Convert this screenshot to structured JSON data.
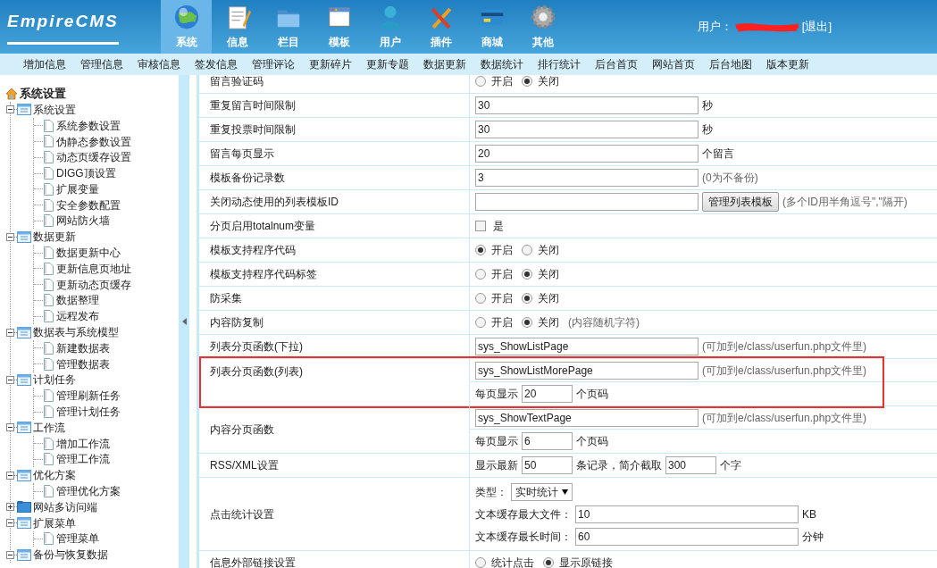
{
  "logo": "EmpireCMS",
  "nav": [
    {
      "label": "系统",
      "selected": true
    },
    {
      "label": "信息",
      "selected": false
    },
    {
      "label": "栏目",
      "selected": false
    },
    {
      "label": "模板",
      "selected": false
    },
    {
      "label": "用户",
      "selected": false
    },
    {
      "label": "插件",
      "selected": false
    },
    {
      "label": "商城",
      "selected": false
    },
    {
      "label": "其他",
      "selected": false
    }
  ],
  "user": {
    "label": "用户：",
    "logout": "[退出]"
  },
  "submenu": [
    "增加信息",
    "管理信息",
    "审核信息",
    "签发信息",
    "管理评论",
    "更新碎片",
    "更新专题",
    "数据更新",
    "数据统计",
    "排行统计",
    "后台首页",
    "网站首页",
    "后台地图",
    "版本更新"
  ],
  "sidebar": {
    "root": "系统设置",
    "groups": [
      {
        "label": "系统设置",
        "expanded": true,
        "children": [
          "系统参数设置",
          "伪静态参数设置",
          "动态页缓存设置",
          "DIGG顶设置",
          "扩展变量",
          "安全参数配置",
          "网站防火墙"
        ]
      },
      {
        "label": "数据更新",
        "expanded": true,
        "children": [
          "数据更新中心",
          "更新信息页地址",
          "更新动态页缓存",
          "数据整理",
          "远程发布"
        ]
      },
      {
        "label": "数据表与系统模型",
        "expanded": true,
        "children": [
          "新建数据表",
          "管理数据表"
        ]
      },
      {
        "label": "计划任务",
        "expanded": true,
        "children": [
          "管理刷新任务",
          "管理计划任务"
        ]
      },
      {
        "label": "工作流",
        "expanded": true,
        "children": [
          "增加工作流",
          "管理工作流"
        ]
      },
      {
        "label": "优化方案",
        "expanded": true,
        "children": [
          "管理优化方案"
        ]
      },
      {
        "label": "网站多访问端",
        "expanded": false
      },
      {
        "label": "扩展菜单",
        "expanded": true,
        "children": [
          "管理菜单"
        ]
      },
      {
        "label": "备份与恢复数据",
        "expanded": true
      }
    ]
  },
  "settings": [
    {
      "label": "留言验证码",
      "highlighted": false,
      "lines": [
        [
          {
            "kind": "radio",
            "label": "开启",
            "selected": false
          },
          {
            "kind": "radio",
            "label": "关闭",
            "selected": true
          }
        ]
      ]
    },
    {
      "label": "重复留言时间限制",
      "highlighted": false,
      "lines": [
        [
          {
            "kind": "input",
            "value": "30"
          },
          {
            "kind": "text",
            "text": "秒"
          }
        ]
      ]
    },
    {
      "label": "重复投票时间限制",
      "highlighted": false,
      "lines": [
        [
          {
            "kind": "input",
            "value": "30"
          },
          {
            "kind": "text",
            "text": "秒"
          }
        ]
      ]
    },
    {
      "label": "留言每页显示",
      "highlighted": false,
      "lines": [
        [
          {
            "kind": "input",
            "value": "20"
          },
          {
            "kind": "text",
            "text": "个留言"
          }
        ]
      ]
    },
    {
      "label": "模板备份记录数",
      "highlighted": false,
      "lines": [
        [
          {
            "kind": "input",
            "value": "3"
          },
          {
            "kind": "note",
            "text": "(0为不备份)"
          }
        ]
      ]
    },
    {
      "label": "关闭动态使用的列表模板ID",
      "highlighted": false,
      "lines": [
        [
          {
            "kind": "input"
          },
          {
            "kind": "button",
            "label": "管理列表模板"
          },
          {
            "kind": "note",
            "text": "(多个ID用半角逗号\",\"隔开)"
          }
        ]
      ]
    },
    {
      "label": "分页启用totalnum变量",
      "highlighted": false,
      "lines": [
        [
          {
            "kind": "checkbox",
            "label": "是",
            "checked": false
          }
        ]
      ]
    },
    {
      "label": "模板支持程序代码",
      "highlighted": false,
      "lines": [
        [
          {
            "kind": "radio",
            "label": "开启",
            "selected": true
          },
          {
            "kind": "radio",
            "label": "关闭",
            "selected": false
          }
        ]
      ]
    },
    {
      "label": "模板支持程序代码标签",
      "highlighted": false,
      "lines": [
        [
          {
            "kind": "radio",
            "label": "开启",
            "selected": false
          },
          {
            "kind": "radio",
            "label": "关闭",
            "selected": true
          }
        ]
      ]
    },
    {
      "label": "防采集",
      "highlighted": false,
      "lines": [
        [
          {
            "kind": "radio",
            "label": "开启",
            "selected": false
          },
          {
            "kind": "radio",
            "label": "关闭",
            "selected": true
          }
        ]
      ]
    },
    {
      "label": "内容防复制",
      "highlighted": false,
      "lines": [
        [
          {
            "kind": "radio",
            "label": "开启",
            "selected": false
          },
          {
            "kind": "radio",
            "label": "关闭",
            "selected": true
          },
          {
            "kind": "note",
            "text": "(内容随机字符)"
          }
        ]
      ]
    },
    {
      "label": "列表分页函数(下拉)",
      "highlighted": false,
      "lines": [
        [
          {
            "kind": "input",
            "value": "sys_ShowListPage"
          },
          {
            "kind": "note",
            "text": "(可加到e/class/userfun.php文件里)"
          }
        ]
      ]
    },
    {
      "label": "列表分页函数(列表)",
      "highlighted": true,
      "lines": [
        [
          {
            "kind": "input",
            "value": "sys_ShowListMorePage"
          },
          {
            "kind": "note",
            "text": "(可加到e/class/userfun.php文件里)"
          }
        ],
        [
          {
            "kind": "text",
            "text": "每页显示"
          },
          {
            "kind": "short_input",
            "value": "20"
          },
          {
            "kind": "text",
            "text": "个页码"
          }
        ]
      ]
    },
    {
      "label": "内容分页函数",
      "highlighted": false,
      "lines": [
        [
          {
            "kind": "input",
            "value": "sys_ShowTextPage"
          },
          {
            "kind": "note",
            "text": "(可加到e/class/userfun.php文件里)"
          }
        ],
        [
          {
            "kind": "text",
            "text": "每页显示"
          },
          {
            "kind": "short_input",
            "value": "6"
          },
          {
            "kind": "text",
            "text": "个页码"
          }
        ]
      ]
    },
    {
      "label": "RSS/XML设置",
      "highlighted": false,
      "lines": [
        [
          {
            "kind": "text",
            "text": "显示最新"
          },
          {
            "kind": "short_input",
            "value": "50"
          },
          {
            "kind": "text",
            "text": "条记录，简介截取"
          },
          {
            "kind": "short_input",
            "value": "300"
          },
          {
            "kind": "text",
            "text": "个字"
          }
        ]
      ]
    },
    {
      "label": "点击统计设置",
      "highlighted": false,
      "lines": [
        [
          {
            "kind": "text",
            "text": "类型："
          },
          {
            "kind": "select",
            "value": "实时统计"
          }
        ],
        [
          {
            "kind": "text",
            "text": "文本缓存最大文件："
          },
          {
            "kind": "input",
            "value": "10"
          },
          {
            "kind": "text",
            "text": "KB"
          }
        ],
        [
          {
            "kind": "text",
            "text": "文本缓存最长时间："
          },
          {
            "kind": "input",
            "value": "60"
          },
          {
            "kind": "text",
            "text": "分钟"
          }
        ]
      ]
    },
    {
      "label": "信息外部链接设置",
      "highlighted": false,
      "lines": [
        [
          {
            "kind": "radio",
            "label": "统计点击",
            "selected": false
          },
          {
            "kind": "radio",
            "label": "显示原链接",
            "selected": true
          }
        ]
      ]
    }
  ]
}
